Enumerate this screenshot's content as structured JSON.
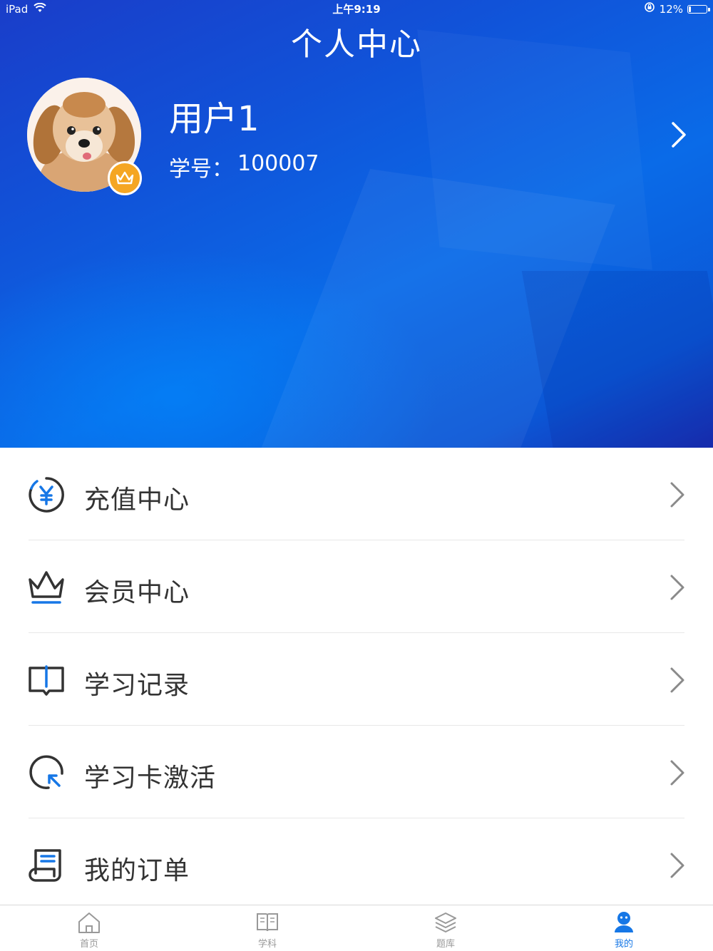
{
  "status_bar": {
    "device": "iPad",
    "time": "上午9:19",
    "battery": "12%",
    "battery_level": 0.12
  },
  "header": {
    "title": "个人中心"
  },
  "profile": {
    "username": "用户1",
    "student_no_label": "学号：",
    "student_no": "100007"
  },
  "menu": {
    "items": [
      {
        "label": "充值中心",
        "icon": "yuan-circle-icon"
      },
      {
        "label": "会员中心",
        "icon": "crown-icon"
      },
      {
        "label": "学习记录",
        "icon": "open-book-icon"
      },
      {
        "label": "学习卡激活",
        "icon": "activate-cursor-icon"
      },
      {
        "label": "我的订单",
        "icon": "order-receipt-icon"
      }
    ]
  },
  "tabbar": {
    "tabs": [
      {
        "label": "首页",
        "icon": "home-icon",
        "active": false
      },
      {
        "label": "学科",
        "icon": "book-icon",
        "active": false
      },
      {
        "label": "题库",
        "icon": "layers-icon",
        "active": false
      },
      {
        "label": "我的",
        "icon": "user-icon",
        "active": true
      }
    ]
  },
  "colors": {
    "accent": "#1677e6",
    "header_blue": "#0b57d6",
    "vip_badge": "#f5a623",
    "text": "#333333",
    "tab_inactive": "#999999"
  }
}
